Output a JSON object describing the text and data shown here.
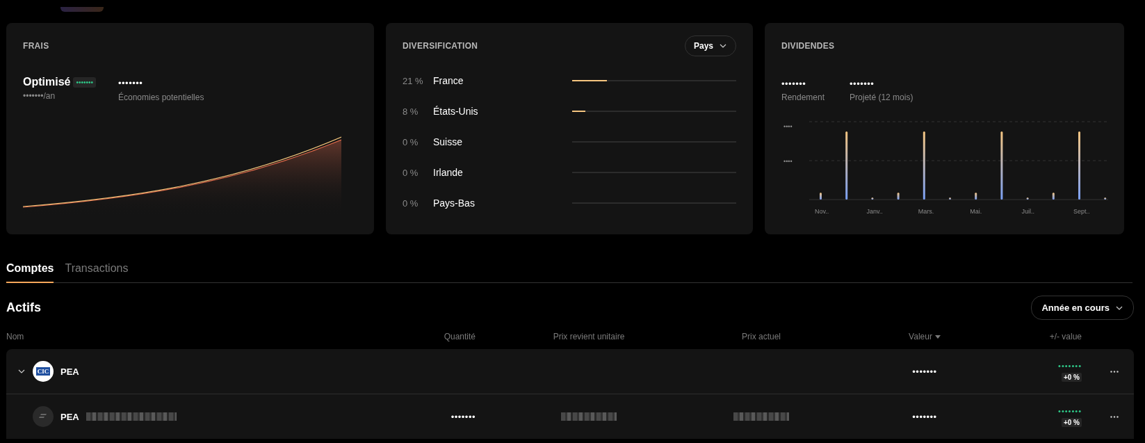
{
  "fees": {
    "title": "FRAIS",
    "status": "Optimisé",
    "badge": "•••••••",
    "per_year": "•••••••/an",
    "savings_value": "•••••••",
    "savings_label": "Économies potentielles"
  },
  "diversification": {
    "title": "DIVERSIFICATION",
    "dropdown": "Pays",
    "rows": [
      {
        "percent": "21 %",
        "name": "France",
        "level": 0.21
      },
      {
        "percent": "8 %",
        "name": "États-Unis",
        "level": 0.08
      },
      {
        "percent": "0 %",
        "name": "Suisse",
        "level": 0
      },
      {
        "percent": "0 %",
        "name": "Irlande",
        "level": 0
      },
      {
        "percent": "0 %",
        "name": "Pays-Bas",
        "level": 0
      }
    ]
  },
  "dividends": {
    "title": "DIVIDENDES",
    "stats": [
      {
        "value": "•••••••",
        "label": "Rendement"
      },
      {
        "value": "•••••••",
        "label": "Projeté (12 mois)"
      }
    ],
    "y_labels": [
      "••••",
      "••••"
    ],
    "x_labels": [
      "Nov..",
      "Janv..",
      "Mars.",
      "Mai.",
      "Juil..",
      "Sept.."
    ]
  },
  "tabs": [
    {
      "label": "Comptes",
      "selected": true
    },
    {
      "label": "Transactions",
      "selected": false
    }
  ],
  "section_title": "Actifs",
  "period_dropdown": "Année en cours",
  "table": {
    "columns": [
      "Nom",
      "Quantité",
      "Prix revient unitaire",
      "Prix actuel",
      "Valeur",
      "+/- value"
    ],
    "rows": [
      {
        "kind": "group",
        "expanded": true,
        "name": "PEA",
        "logo": "CIC",
        "name_redacted": false,
        "unit_cost_redacted": false,
        "price_redacted": false,
        "value": "•••••••",
        "gain": "•••••••",
        "gain_pct": "+0 %"
      },
      {
        "kind": "holding",
        "name": "PEA",
        "quantity": "•••••••",
        "name_redacted": true,
        "unit_cost_redacted": true,
        "price_redacted": true,
        "value": "•••••••",
        "gain": "•••••••",
        "gain_pct": "+0 %"
      }
    ]
  }
}
